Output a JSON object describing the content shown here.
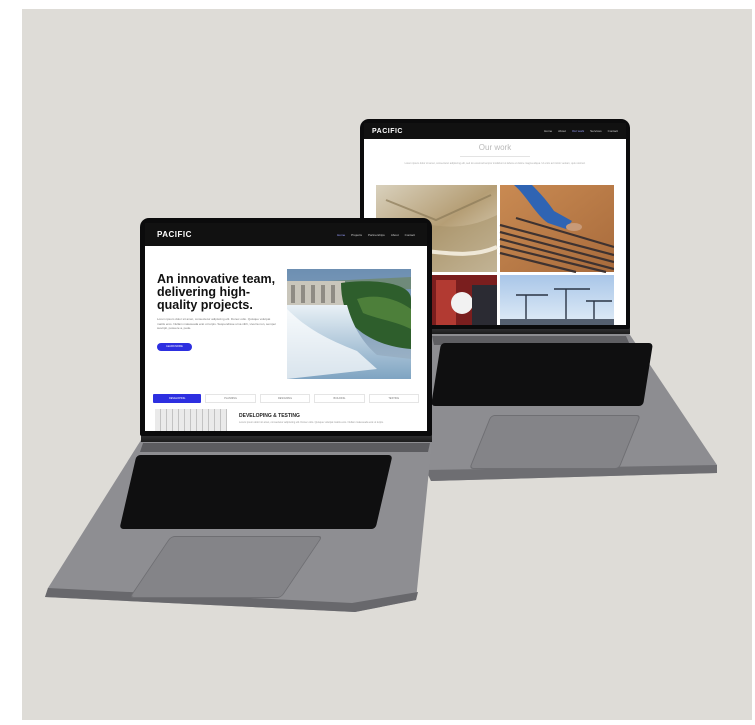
{
  "back_laptop": {
    "logo": "PACIFIC",
    "nav": [
      "Home",
      "About",
      "Our work",
      "Services",
      "Contact"
    ],
    "section_title": "Our work",
    "intro_text": "Lorem ipsum dolor sit amet, consectetur adipiscing elit, sed do eiusmod tempor incididunt ut labore et dolore magna aliqua. Ut enim ad minim veniam, quis nostrud."
  },
  "front_laptop": {
    "logo": "PACIFIC",
    "nav": [
      "Home",
      "Projects",
      "Partnerships",
      "About",
      "Contact"
    ],
    "hero_heading": "An innovative team, delivering high-quality projects.",
    "hero_body": "Lorem ipsum dolor sit amet, consectetur adipiscing elit. Donec odio. Quisque volutpat mattis eros. Nullam malesuada erat ut turpis. Suspendisse urna nibh, viverra non, semper suscipit, posuere a, pede.",
    "hero_button": "LEARN MORE",
    "tabs": [
      "DEVELOPING",
      "PLANNING",
      "DESIGNING",
      "BUILDING",
      "TESTING"
    ],
    "section_heading": "DEVELOPING & TESTING",
    "section_body": "Lorem ipsum dolor sit amet, consectetur adipiscing elit. Donec odio. Quisque volutpat mattis eros. Nullam malesuada erat ut turpis."
  },
  "colors": {
    "background": "#dedcd7",
    "accent": "#2d2fe0",
    "nav_bar": "#111111",
    "laptop_body": "#8e8e92"
  }
}
